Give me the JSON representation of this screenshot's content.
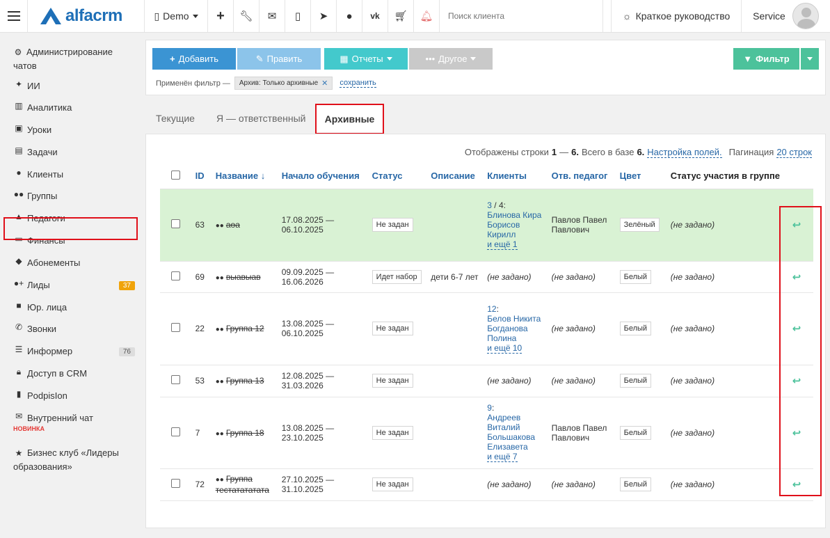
{
  "topbar": {
    "logo_text": "alfacrm",
    "branch": "Demo",
    "search_placeholder": "Поиск клиента",
    "guide_label": "Краткое руководство",
    "user_name": "Service"
  },
  "sidebar": {
    "items": [
      {
        "label": "Администрирование чатов",
        "icon": "gear-icon"
      },
      {
        "label": "ИИ",
        "icon": "sparkle-icon"
      },
      {
        "label": "Аналитика",
        "icon": "map-icon"
      },
      {
        "label": "Уроки",
        "icon": "calendar-icon"
      },
      {
        "label": "Задачи",
        "icon": "clipboard-icon"
      },
      {
        "label": "Клиенты",
        "icon": "user-icon"
      },
      {
        "label": "Группы",
        "icon": "users-icon"
      },
      {
        "label": "Педагоги",
        "icon": "graduation-cap-icon"
      },
      {
        "label": "Финансы",
        "icon": "money-icon"
      },
      {
        "label": "Абонементы",
        "icon": "tag-icon"
      },
      {
        "label": "Лиды",
        "icon": "user-plus-icon",
        "badge": "37"
      },
      {
        "label": "Юр. лица",
        "icon": "briefcase-icon"
      },
      {
        "label": "Звонки",
        "icon": "phone-icon"
      },
      {
        "label": "Информер",
        "icon": "list-icon",
        "badge": "76"
      },
      {
        "label": "Доступ в CRM",
        "icon": "lock-icon"
      },
      {
        "label": "PodpisIon",
        "icon": "document-icon"
      },
      {
        "label": "Внутренний чат",
        "icon": "envelope-icon",
        "note": "НОВИНКА"
      },
      {
        "label": "Бизнес клуб «Лидеры образования»",
        "icon": "star-icon"
      }
    ]
  },
  "toolbar": {
    "add_label": "Добавить",
    "edit_label": "Править",
    "reports_label": "Отчеты",
    "other_label": "Другое",
    "filter_label": "Фильтр"
  },
  "filter": {
    "applied_label": "Применён фильтр —",
    "chip_label": "Архив: Только архивные",
    "save_label": "сохранить"
  },
  "tabs": {
    "current": "Текущие",
    "mine": "Я — ответственный",
    "archive": "Архивные"
  },
  "info": {
    "shown_prefix": "Отображены строки",
    "range_from": "1",
    "range_sep": "—",
    "range_to": "6.",
    "total_prefix": "Всего в базе",
    "total": "6.",
    "fields_link": "Настройка полей.",
    "pagination_label": "Пагинация",
    "pagination_link": "20 строк"
  },
  "table": {
    "headers": {
      "id": "ID",
      "name": "Название ↓",
      "start": "Начало обучения",
      "status": "Статус",
      "description": "Описание",
      "clients": "Клиенты",
      "teacher": "Отв. педагог",
      "color": "Цвет",
      "participation": "Статус участия в группе"
    },
    "rows": [
      {
        "id": "63",
        "name": "аоа",
        "start1": "17.08.2025 —",
        "start2": "06.10.2025",
        "status": "Не задан",
        "description": "",
        "clients_count": "3",
        "clients_total": " / 4:",
        "clients": [
          "Блинова Кира",
          "Борисов Кирилл"
        ],
        "clients_more": "и ещё 1",
        "teacher": "Павлов Павел Павлович",
        "color": "Зелёный",
        "participation": "(не задано)"
      },
      {
        "id": "69",
        "name": "выавыав",
        "start1": "09.09.2025 —",
        "start2": "16.06.2026",
        "status": "Идет набор",
        "description": "дети 6-7 лет",
        "clients_notset": "(не задано)",
        "teacher_notset": "(не задано)",
        "color": "Белый",
        "participation": "(не задано)"
      },
      {
        "id": "22",
        "name": "Группа 12",
        "start1": "13.08.2025 —",
        "start2": "06.10.2025",
        "status": "Не задан",
        "description": "",
        "clients_count": "12",
        "clients_total": ":",
        "clients": [
          "Белов Никита",
          "Богданова Полина"
        ],
        "clients_more": "и ещё 10",
        "teacher_notset": "(не задано)",
        "color": "Белый",
        "participation": "(не задано)"
      },
      {
        "id": "53",
        "name": "Группа 13",
        "start1": "12.08.2025 —",
        "start2": "31.03.2026",
        "status": "Не задан",
        "description": "",
        "clients_notset": "(не задано)",
        "teacher_notset": "(не задано)",
        "color": "Белый",
        "participation": "(не задано)"
      },
      {
        "id": "7",
        "name": "Группа 18",
        "start1": "13.08.2025 —",
        "start2": "23.10.2025",
        "status": "Не задан",
        "description": "",
        "clients_count": "9",
        "clients_total": ":",
        "clients": [
          "Андреев Виталий",
          "Большакова Елизавета"
        ],
        "clients_more": "и ещё 7",
        "teacher": "Павлов Павел Павлович",
        "color": "Белый",
        "participation": "(не задано)"
      },
      {
        "id": "72",
        "name": "Группа тестатататата",
        "start1": "27.10.2025 —",
        "start2": "31.10.2025",
        "status": "Не задан",
        "description": "",
        "clients_notset": "(не задано)",
        "teacher_notset": "(не задано)",
        "color": "Белый",
        "participation": "(не задано)"
      }
    ]
  },
  "colors": {
    "accent": "#3b94d3",
    "filter_green": "#4cc29b",
    "highlight_red": "#e0101a",
    "row_green": "#d9f2d4"
  }
}
